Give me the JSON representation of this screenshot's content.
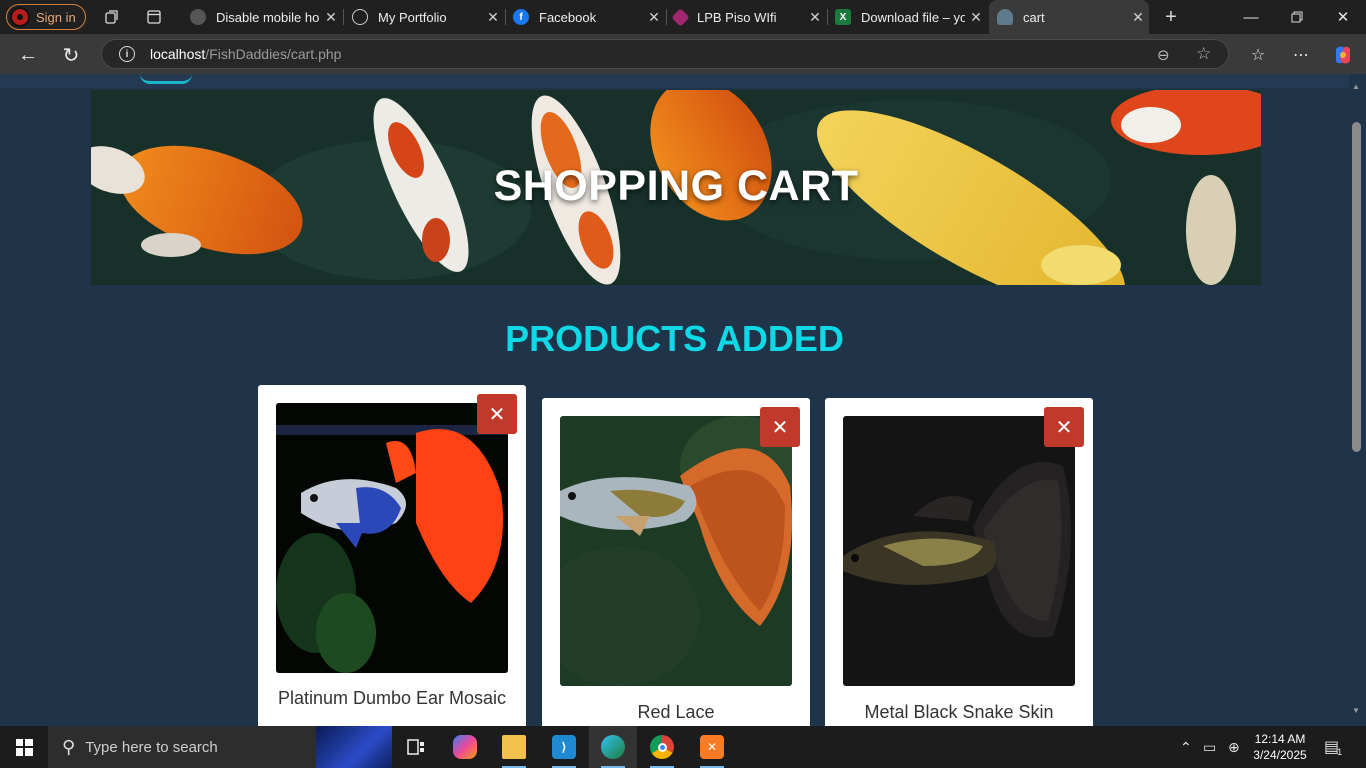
{
  "browser": {
    "signin_label": "Sign in",
    "tabs": [
      {
        "title": "Disable mobile hor",
        "icon": "settings-globe-icon"
      },
      {
        "title": "My Portfolio",
        "icon": "globe-icon"
      },
      {
        "title": "Facebook",
        "icon": "facebook-icon"
      },
      {
        "title": "LPB Piso WIfi",
        "icon": "wifi-portal-icon"
      },
      {
        "title": "Download file – yo",
        "icon": "excel-icon"
      },
      {
        "title": "cart",
        "icon": "fish-icon"
      }
    ],
    "url_host": "localhost",
    "url_path": "/FishDaddies/cart.php"
  },
  "page": {
    "hero_title": "SHOPPING CART",
    "section_title": "PRODUCTS ADDED",
    "products": [
      {
        "name": "Platinum Dumbo Ear Mosaic",
        "remove_label": "✕"
      },
      {
        "name": "Red Lace",
        "remove_label": "✕"
      },
      {
        "name": "Metal Black Snake Skin",
        "remove_label": "✕"
      }
    ]
  },
  "taskbar": {
    "search_placeholder": "Type here to search",
    "time": "12:14 AM",
    "date": "3/24/2025",
    "notification_count": "1"
  },
  "colors": {
    "page_bg": "#1f3349",
    "accent_cyan": "#0fd9e6",
    "remove_red": "#c0392b"
  }
}
